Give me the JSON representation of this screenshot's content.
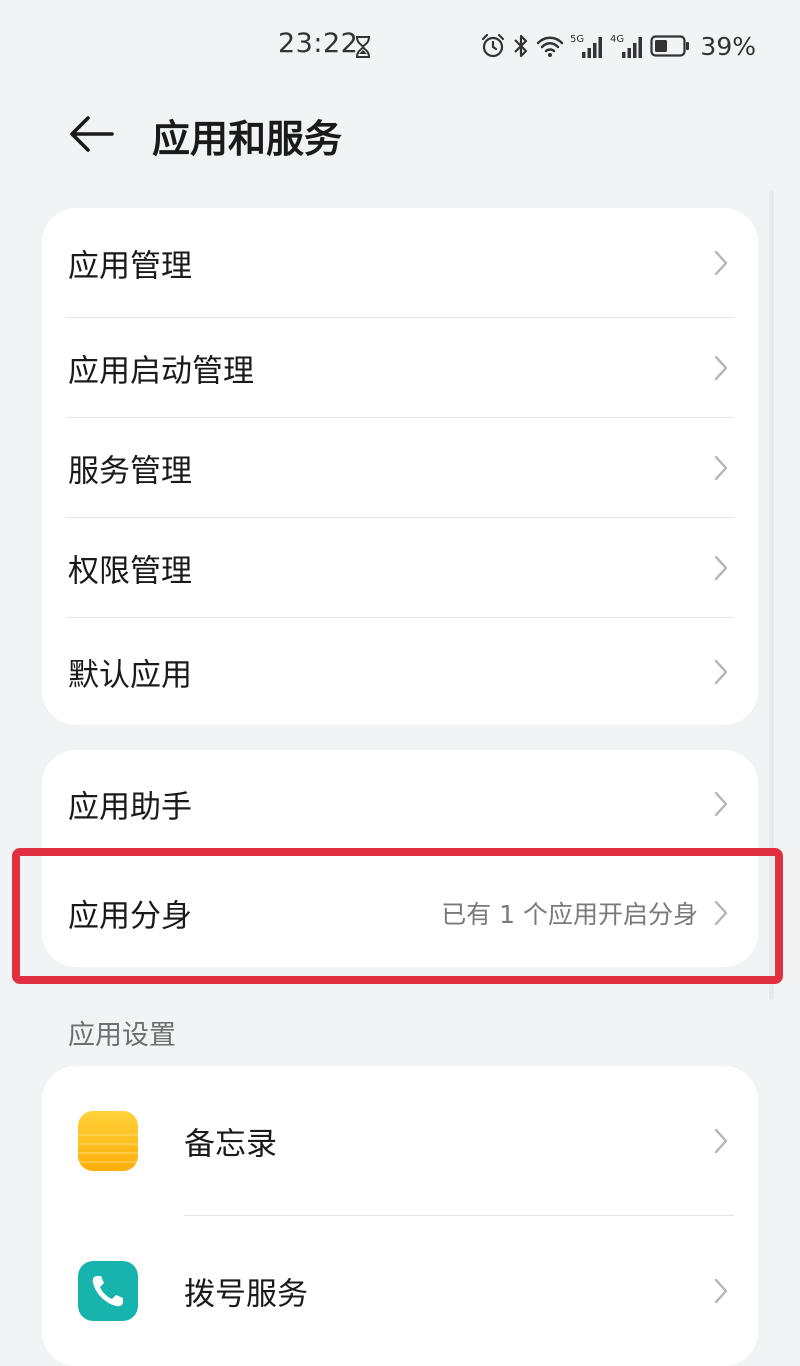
{
  "status_bar": {
    "time": "23:22",
    "battery": "39%",
    "signal_1_label": "5G",
    "signal_2_label": "4G"
  },
  "header": {
    "title": "应用和服务"
  },
  "group_1": [
    {
      "label": "应用管理"
    },
    {
      "label": "应用启动管理"
    },
    {
      "label": "服务管理"
    },
    {
      "label": "权限管理"
    },
    {
      "label": "默认应用"
    }
  ],
  "group_2": [
    {
      "label": "应用助手",
      "value": ""
    },
    {
      "label": "应用分身",
      "value": "已有 1 个应用开启分身"
    }
  ],
  "section_app_settings": {
    "title": "应用设置",
    "apps": [
      {
        "label": "备忘录",
        "icon": "notepad-icon",
        "color": "#ffbf17"
      },
      {
        "label": "拨号服务",
        "icon": "phone-icon",
        "color": "#18b5b1"
      }
    ]
  },
  "colors": {
    "background": "#f1f3f5",
    "card": "#ffffff",
    "highlight": "#e0303f"
  }
}
